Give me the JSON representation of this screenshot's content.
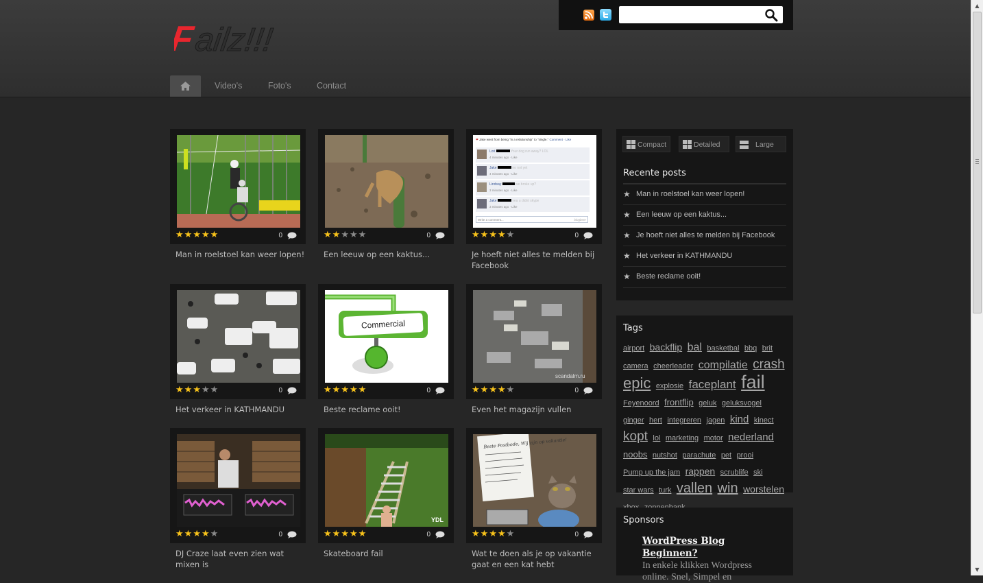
{
  "site": {
    "logo_text": "Failz!!!",
    "search": {
      "value": "",
      "placeholder": ""
    }
  },
  "nav": {
    "items": [
      {
        "label": "Video's"
      },
      {
        "label": "Foto's"
      },
      {
        "label": "Contact"
      }
    ]
  },
  "posts": [
    {
      "title": "Man in roelstoel kan weer lopen!",
      "rating": 5,
      "comments": "0"
    },
    {
      "title": "Een leeuw op een kaktus...",
      "rating": 2,
      "comments": "0"
    },
    {
      "title": "Je hoeft niet alles te melden bij Facebook",
      "rating": 4,
      "comments": "0"
    },
    {
      "title": "Het verkeer in KATHMANDU",
      "rating": 3,
      "comments": "0"
    },
    {
      "title": "Beste reclame ooit!",
      "rating": 5,
      "comments": "0"
    },
    {
      "title": "Even het magazijn vullen",
      "rating": 4,
      "comments": "0"
    },
    {
      "title": "DJ Craze laat even zien wat mixen is",
      "rating": 4,
      "comments": "0"
    },
    {
      "title": "Skateboard fail",
      "rating": 5,
      "comments": "0"
    },
    {
      "title": "Wat te doen als je op vakantie gaat en een kat hebt",
      "rating": 4,
      "comments": "0"
    }
  ],
  "thumb_text": {
    "facebook_header": "Jake went from being \"in a relationship\" to \"single.\"",
    "facebook_actions": "Comment · Like",
    "facebook_rows": [
      {
        "name": "Lori",
        "msg": "Your dog run away? LOL",
        "time": "4 minutes ago · Like"
      },
      {
        "name": "Jake",
        "msg": "no not yet",
        "time": "4 minutes ago · Like"
      },
      {
        "name": "Lindsay",
        "msg": "we broke up?",
        "time": "3 minutes ago · Like"
      },
      {
        "name": "Jake",
        "msg": "yea u didnt skype",
        "time": "3 minutes ago · Like"
      }
    ],
    "facebook_input": "Write a comment...",
    "facebook_credit": "blogbeer",
    "commercial": "Commercial",
    "magazijn_watermark": "scandalm.ru",
    "skate_watermark": "YDL",
    "cat_note": "Beste Postbode, Wij zijn op vakantie!"
  },
  "views": {
    "compact": "Compact",
    "detailed": "Detailed",
    "large": "Large"
  },
  "recent": {
    "title": "Recente posts",
    "items": [
      "Man in roelstoel kan weer lopen!",
      "Een leeuw op een kaktus...",
      "Je hoeft niet alles te melden bij Facebook",
      "Het verkeer in KATHMANDU",
      "Beste reclame ooit!"
    ]
  },
  "tags": {
    "title": "Tags",
    "items": [
      {
        "label": "airport",
        "size": 11
      },
      {
        "label": "backflip",
        "size": 14
      },
      {
        "label": "bal",
        "size": 16
      },
      {
        "label": "basketbal",
        "size": 11
      },
      {
        "label": "bbq",
        "size": 11
      },
      {
        "label": "brit",
        "size": 11
      },
      {
        "label": "camera",
        "size": 11
      },
      {
        "label": "cheerleader",
        "size": 11
      },
      {
        "label": "compilatie",
        "size": 16
      },
      {
        "label": "crash",
        "size": 19
      },
      {
        "label": "epic",
        "size": 22
      },
      {
        "label": "explosie",
        "size": 11
      },
      {
        "label": "faceplant",
        "size": 17
      },
      {
        "label": "fail",
        "size": 27
      },
      {
        "label": "Feyenoord",
        "size": 11
      },
      {
        "label": "frontflip",
        "size": 13
      },
      {
        "label": "geluk",
        "size": 11
      },
      {
        "label": "geluksvogel",
        "size": 11
      },
      {
        "label": "ginger",
        "size": 11
      },
      {
        "label": "hert",
        "size": 11
      },
      {
        "label": "integreren",
        "size": 11
      },
      {
        "label": "jagen",
        "size": 11
      },
      {
        "label": "kind",
        "size": 15
      },
      {
        "label": "kinect",
        "size": 11
      },
      {
        "label": "kopt",
        "size": 19
      },
      {
        "label": "lol",
        "size": 11
      },
      {
        "label": "marketing",
        "size": 11
      },
      {
        "label": "motor",
        "size": 11
      },
      {
        "label": "nederland",
        "size": 15
      },
      {
        "label": "noobs",
        "size": 13
      },
      {
        "label": "nutshot",
        "size": 11
      },
      {
        "label": "parachute",
        "size": 11
      },
      {
        "label": "pet",
        "size": 11
      },
      {
        "label": "prooi",
        "size": 11
      },
      {
        "label": "Pump up the jam",
        "size": 11
      },
      {
        "label": "rappen",
        "size": 14
      },
      {
        "label": "scrublife",
        "size": 11
      },
      {
        "label": "ski",
        "size": 11
      },
      {
        "label": "star wars",
        "size": 11
      },
      {
        "label": "turk",
        "size": 11
      },
      {
        "label": "vallen",
        "size": 20
      },
      {
        "label": "win",
        "size": 20
      },
      {
        "label": "worstelen",
        "size": 14
      },
      {
        "label": "xbox",
        "size": 11
      },
      {
        "label": "zonnenbank",
        "size": 11
      }
    ]
  },
  "sponsors": {
    "title": "Sponsors",
    "link_title": "WordPress Blog Beginnen?",
    "text": "In enkele klikken Wordpress online. Snel, Simpel en"
  },
  "colors": {
    "star_on": "#f7c21b",
    "logo_red": "#e8262e"
  },
  "icons": [
    "home-icon",
    "rss-icon",
    "twitter-icon",
    "search-icon",
    "comment-icon",
    "star-icon",
    "grid-icon",
    "list-icon"
  ]
}
